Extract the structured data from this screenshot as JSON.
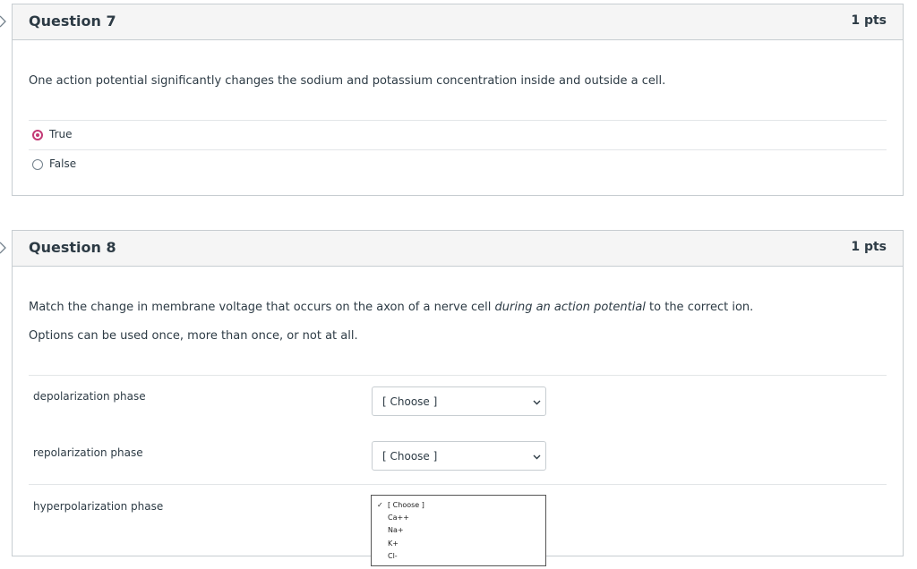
{
  "question7": {
    "title": "Question 7",
    "points": "1 pts",
    "text": "One action potential significantly changes the sodium and potassium concentration inside and outside a cell.",
    "answers": [
      {
        "label": "True",
        "selected": true
      },
      {
        "label": "False",
        "selected": false
      }
    ]
  },
  "question8": {
    "title": "Question 8",
    "points": "1 pts",
    "text_before": "Match the change in membrane voltage that occurs on the axon of a nerve cell ",
    "text_emphasis": "during an action potential",
    "text_after": " to the correct ion.",
    "note": "Options can be used once, more than once, or not at all.",
    "matches": [
      {
        "label": "depolarization phase",
        "selected": "[ Choose ]"
      },
      {
        "label": "repolarization phase",
        "selected": "[ Choose ]"
      },
      {
        "label": "hyperpolarization phase",
        "selected": "[ Choose ]"
      }
    ],
    "dropdown_options": [
      "[ Choose ]",
      "Ca++",
      "Na+",
      "K+",
      "Cl-"
    ],
    "dropdown_check": "✓"
  },
  "colors": {
    "accent": "#c33a76",
    "header_bg": "#f5f5f5",
    "border": "#c7cdd1",
    "text": "#2d3b45"
  },
  "icons": {
    "collapse": "chevron-right-icon",
    "select": "chevron-down-icon",
    "selected_option": "checkmark-icon"
  }
}
